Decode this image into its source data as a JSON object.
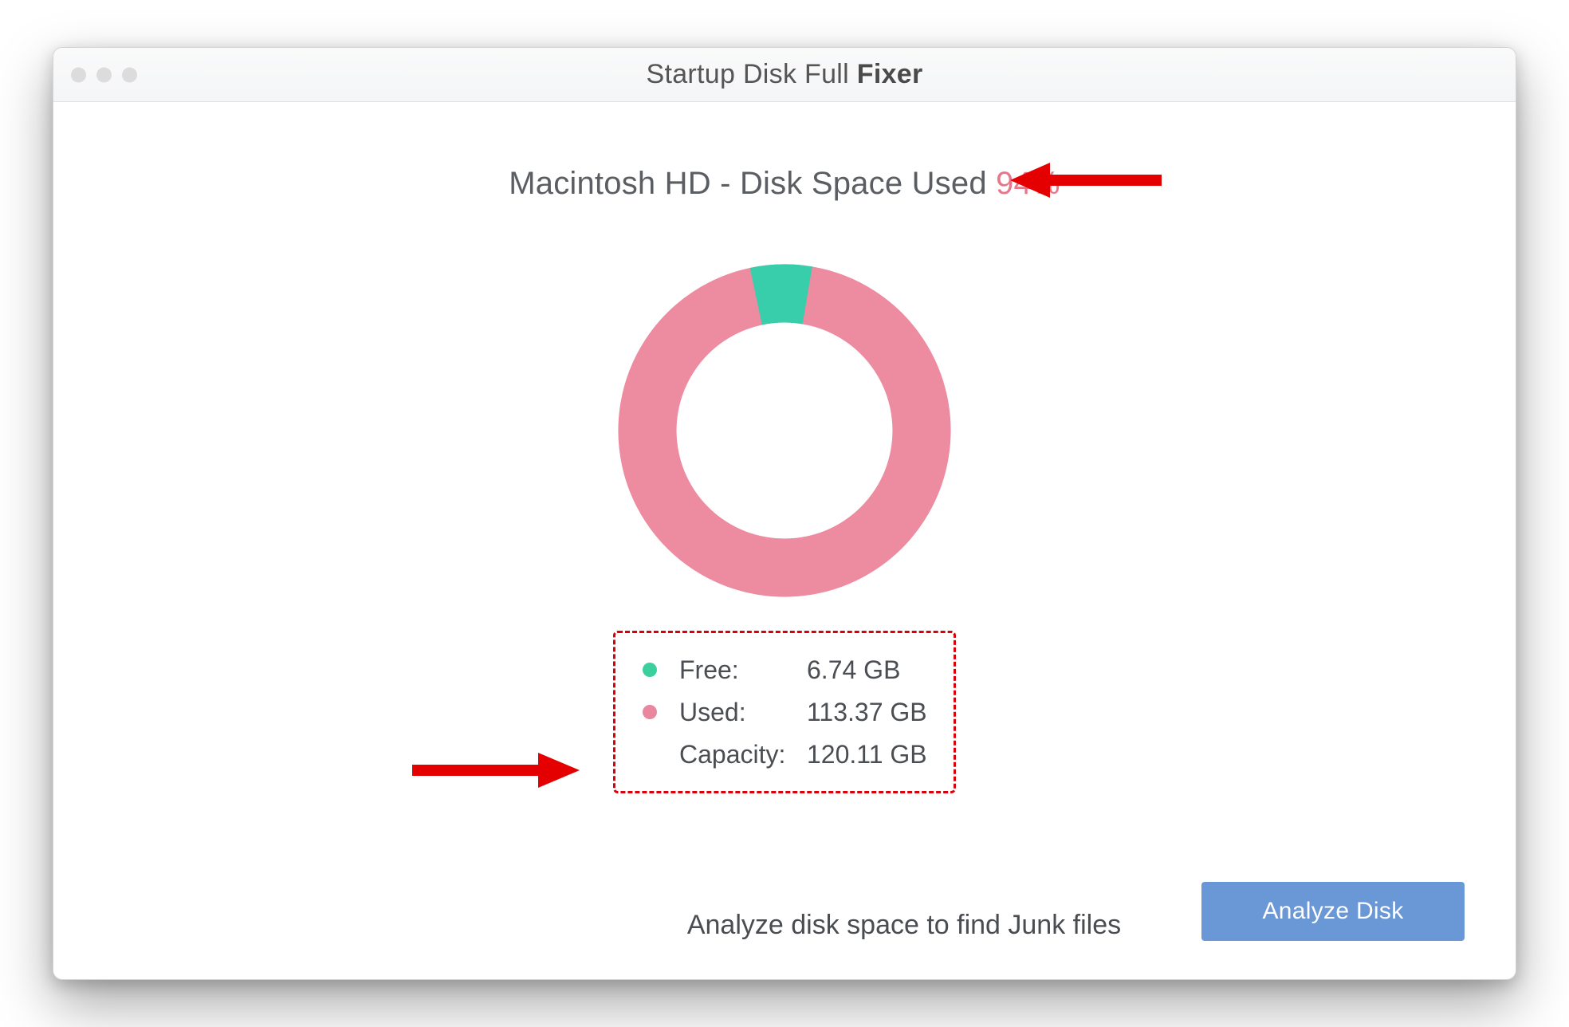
{
  "window": {
    "title_prefix": "Startup Disk Full ",
    "title_bold": "Fixer"
  },
  "heading": {
    "disk_label": "Macintosh HD - Disk Space Used ",
    "percent_text": "94%"
  },
  "chart_data": {
    "type": "pie",
    "title": "Disk Space Used",
    "series": [
      {
        "name": "Used",
        "value": 113.37,
        "percent": 94,
        "color": "#ed8ba0"
      },
      {
        "name": "Free",
        "value": 6.74,
        "percent": 6,
        "color": "#38ceab"
      }
    ],
    "unit": "GB",
    "capacity": 120.11
  },
  "stats": {
    "free_label": "Free:",
    "free_value": "6.74 GB",
    "used_label": "Used:",
    "used_value": "113.37 GB",
    "capacity_label": "Capacity:",
    "capacity_value": "120.11 GB"
  },
  "footer": {
    "hint": "Analyze disk space to find Junk files",
    "button": "Analyze Disk"
  },
  "colors": {
    "used": "#ed8ba0",
    "free": "#38ceab",
    "accent": "#6a97d6",
    "annotation": "#d9000a"
  }
}
